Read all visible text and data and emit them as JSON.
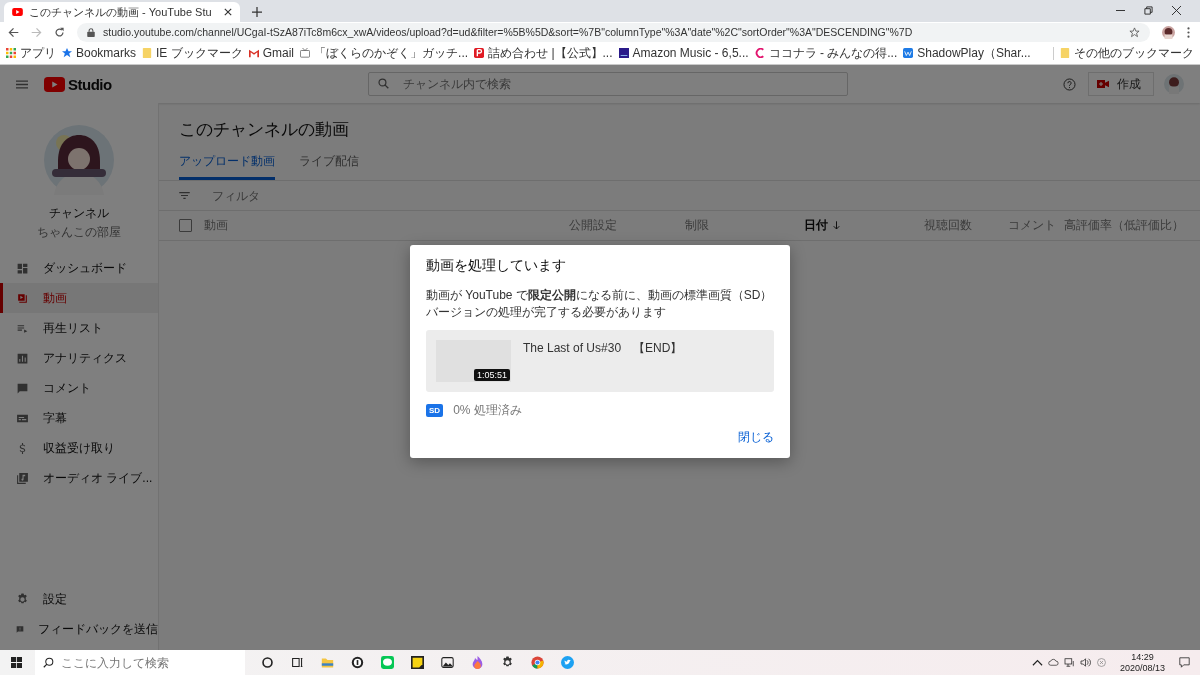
{
  "browser": {
    "tab_title": "このチャンネルの動画 - YouTube Stu",
    "url": "studio.youtube.com/channel/UCgaI-tSzA87iTc8m6cx_xwA/videos/upload?d=ud&filter=%5B%5D&sort=%7B\"columnType\"%3A\"date\"%2C\"sortOrder\"%3A\"DESCENDING\"%7D",
    "bookmarks": [
      {
        "label": "アプリ",
        "kind": "apps"
      },
      {
        "label": "Bookmarks",
        "kind": "star"
      },
      {
        "label": "IE ブックマーク",
        "kind": "folder"
      },
      {
        "label": "Gmail",
        "kind": "mail"
      },
      {
        "label": "「ぼくらのかぞく」ガッチ...",
        "kind": "tv"
      },
      {
        "label": "詰め合わせ |【公式】...",
        "kind": "p"
      },
      {
        "label": "Amazon Music - 6,5...",
        "kind": "music"
      },
      {
        "label": "ココナラ - みんなの得...",
        "kind": "c"
      },
      {
        "label": "ShadowPlay（Shar...",
        "kind": "w"
      }
    ],
    "other_bookmarks": "その他のブックマーク"
  },
  "studio": {
    "logo": "Studio",
    "search_placeholder": "チャンネル内で検索",
    "create_label": "作成",
    "channel": {
      "name": "チャンネル",
      "subtitle": "ちゃんこの部屋"
    },
    "nav": [
      {
        "label": "ダッシュボード",
        "selected": false
      },
      {
        "label": "動画",
        "selected": true
      },
      {
        "label": "再生リスト",
        "selected": false
      },
      {
        "label": "アナリティクス",
        "selected": false
      },
      {
        "label": "コメント",
        "selected": false
      },
      {
        "label": "字幕",
        "selected": false
      },
      {
        "label": "収益受け取り",
        "selected": false
      },
      {
        "label": "オーディオ ライブ...",
        "selected": false
      }
    ],
    "nav_bottom": [
      {
        "label": "設定"
      },
      {
        "label": "フィードバックを送信"
      }
    ],
    "page_title": "このチャンネルの動画",
    "tabs": [
      {
        "label": "アップロード動画",
        "selected": true
      },
      {
        "label": "ライブ配信",
        "selected": false
      }
    ],
    "filter_placeholder": "フィルタ",
    "select_all": {
      "checked": false
    },
    "columns": [
      {
        "label": "動画",
        "sorted": false
      },
      {
        "label": "公開設定",
        "sorted": false
      },
      {
        "label": "制限",
        "sorted": false
      },
      {
        "label": "日付",
        "sorted": true
      },
      {
        "label": "視聴回数",
        "sorted": false
      },
      {
        "label": "コメント",
        "sorted": false
      },
      {
        "label": "高評価率（低評価比）",
        "sorted": false
      }
    ]
  },
  "dialog": {
    "title": "動画を処理しています",
    "message": "動画が YouTube で**限定公開**になる前に、動画の標準画質（SD）バージョンの処理が完了する必要があります",
    "video": {
      "title": "The Last of Us#30　【END】",
      "duration": "1:05:51"
    },
    "badge": "SD",
    "progress": "0% 処理済み",
    "close": "閉じる"
  },
  "taskbar": {
    "search_placeholder": "ここに入力して検索",
    "time": "14:29",
    "date": "2020/08/13"
  }
}
